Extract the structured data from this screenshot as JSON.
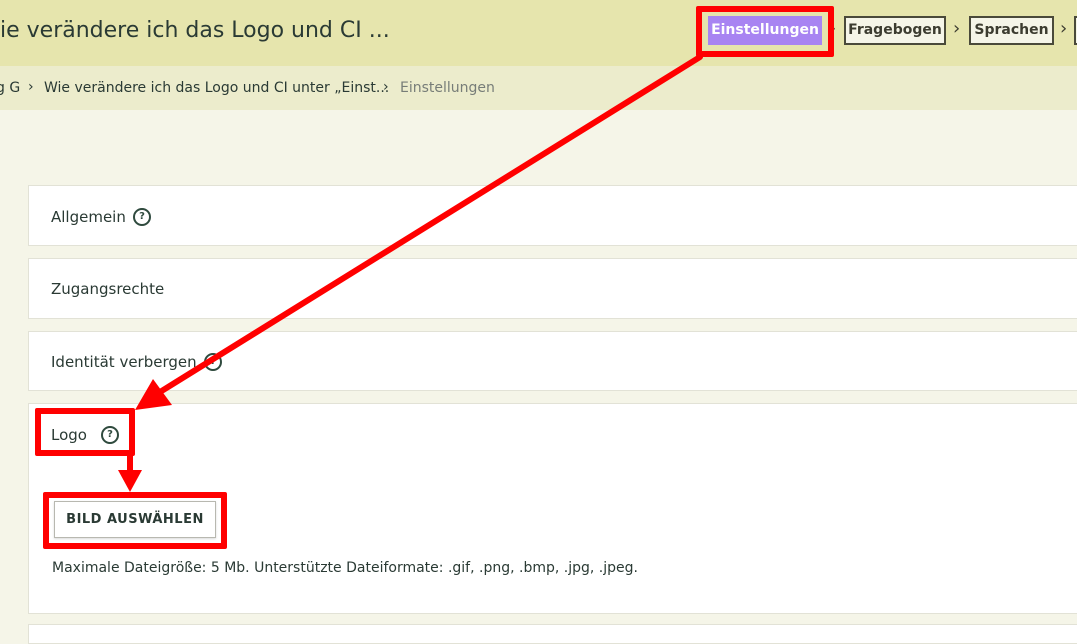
{
  "header": {
    "title": "ie verändere ich das Logo und CI ...",
    "steps": [
      {
        "label": "Einstellungen",
        "active": true
      },
      {
        "label": "Fragebogen",
        "active": false
      },
      {
        "label": "Sprachen",
        "active": false
      }
    ],
    "step_separator": "›"
  },
  "breadcrumb": {
    "items": [
      "g G",
      "Wie verändere ich das Logo und CI unter „Einst...",
      "Einstellungen"
    ],
    "separator": "›"
  },
  "panels": [
    {
      "label": "Allgemein",
      "help": "?"
    },
    {
      "label": "Zugangsrechte"
    },
    {
      "label": "Identität verbergen",
      "help": "?"
    },
    {
      "label": "Logo",
      "help": "?"
    }
  ],
  "logo_section": {
    "upload_button": "BILD AUSWÄHLEN",
    "hint": "Maximale Dateigröße: 5 Mb. Unterstützte Dateiformate: .gif, .png, .bmp, .jpg, .jpeg."
  },
  "colors": {
    "accent": "#a884f2",
    "header_bg": "#e6e5ad",
    "annotation": "#ff0000"
  }
}
